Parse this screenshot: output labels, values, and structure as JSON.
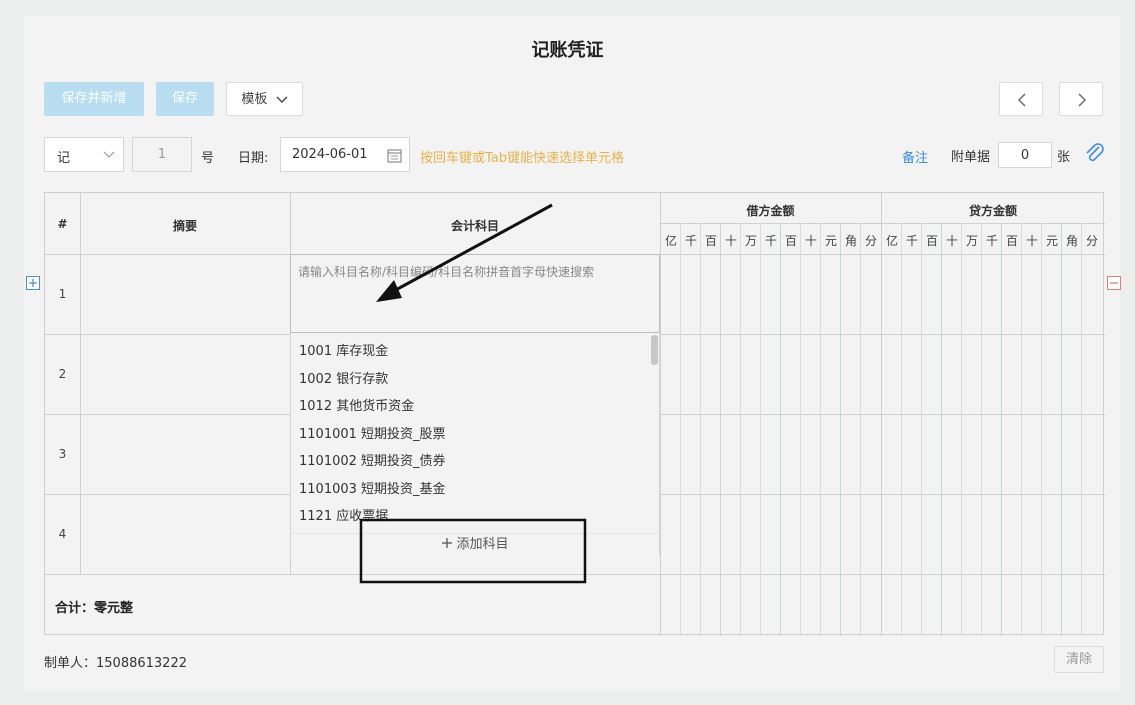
{
  "page": {
    "title": "记账凭证"
  },
  "toolbar": {
    "save_new_label": "保存并新增",
    "save_label": "保存",
    "template_label": "模板"
  },
  "form": {
    "voucher_type": "记",
    "voucher_number": "1",
    "number_suffix": "号",
    "date_label": "日期:",
    "date_value": "2024-06-01",
    "hint": "按回车键或Tab键能快速选择单元格",
    "note_label": "备注",
    "attachments_label": "附单据",
    "attachments_value": "0",
    "attachments_unit": "张"
  },
  "table": {
    "col_index": "#",
    "col_summary": "摘要",
    "col_subject": "会计科目",
    "col_debit": "借方金额",
    "col_credit": "贷方金额",
    "units": [
      "亿",
      "千",
      "百",
      "十",
      "万",
      "千",
      "百",
      "十",
      "元",
      "角",
      "分"
    ],
    "rows": [
      "1",
      "2",
      "3",
      "4"
    ],
    "subject_placeholder": "请输入科目名称/科目编码/科目名称拼音首字母快速搜索",
    "total_label": "合计：零元整"
  },
  "dropdown": {
    "options": [
      "1001 库存现金",
      "1002 银行存款",
      "1012 其他货币资金",
      "1101001 短期投资_股票",
      "1101002 短期投资_债券",
      "1101003 短期投资_基金",
      "1121 应收票据"
    ],
    "add_label": "添加科目"
  },
  "footer": {
    "creator": "制单人：15088613222",
    "clear_label": "清除"
  },
  "colors": {
    "primary_disabled": "#b8dcf0",
    "hint": "#e8b24a",
    "link": "#3a8ee6",
    "add": "#4a90d9",
    "remove": "#e07b8a"
  }
}
